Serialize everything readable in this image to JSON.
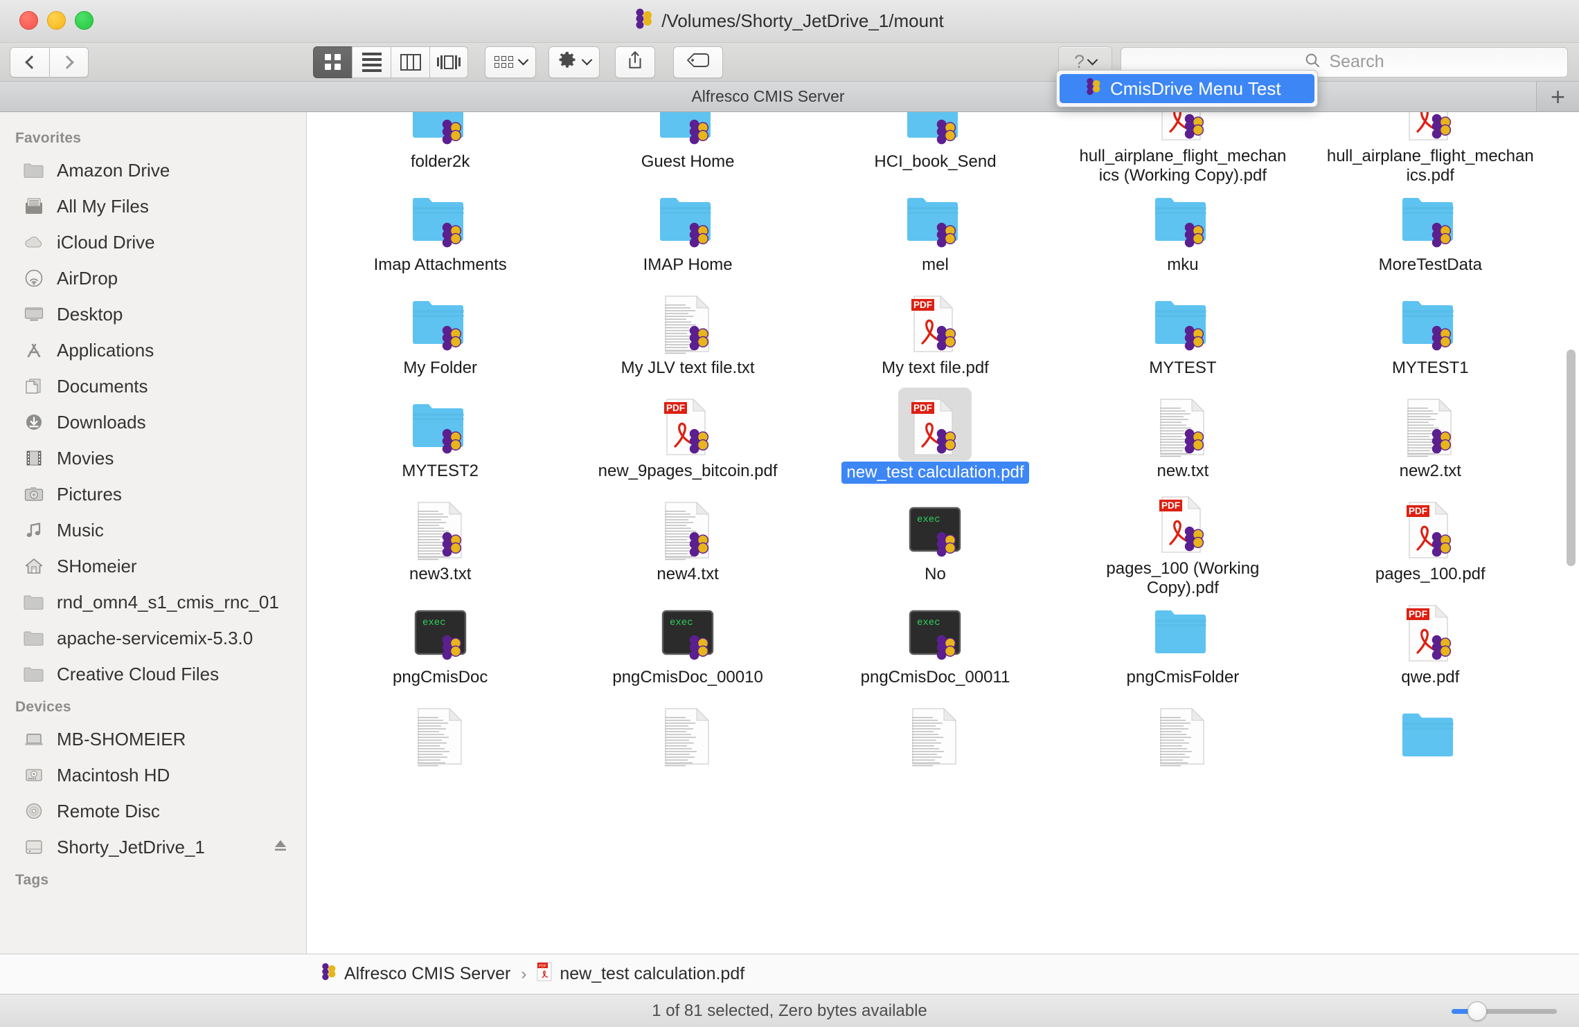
{
  "window": {
    "title": "/Volumes/Shorty_JetDrive_1/mount",
    "title_icon": "alfresco-logo-icon",
    "traffic_lights": [
      "close",
      "minimize",
      "zoom"
    ]
  },
  "toolbar": {
    "back_label": "Back",
    "forward_label": "Forward",
    "view_modes": [
      {
        "name": "icon-view",
        "active": true
      },
      {
        "name": "list-view",
        "active": false
      },
      {
        "name": "column-view",
        "active": false
      },
      {
        "name": "cover-flow-view",
        "active": false
      }
    ],
    "arrange_label": "Arrange",
    "action_label": "Action",
    "share_label": "Share",
    "tags_label": "Edit Tags",
    "help_label": "?",
    "search": {
      "placeholder": "Search",
      "value": ""
    }
  },
  "dropdown": {
    "open": true,
    "items": [
      {
        "label": "CmisDrive Menu Test",
        "icon": "alfresco-logo-icon",
        "selected": true
      }
    ]
  },
  "tabbar": {
    "tabs": [
      {
        "label": "Alfresco CMIS Server",
        "active": true
      }
    ],
    "add_label": "+"
  },
  "sidebar": {
    "sections": [
      {
        "header": "Favorites",
        "items": [
          {
            "label": "Amazon Drive",
            "icon": "folder-icon"
          },
          {
            "label": "All My Files",
            "icon": "all-my-files-icon"
          },
          {
            "label": "iCloud Drive",
            "icon": "cloud-icon"
          },
          {
            "label": "AirDrop",
            "icon": "airdrop-icon"
          },
          {
            "label": "Desktop",
            "icon": "desktop-icon"
          },
          {
            "label": "Applications",
            "icon": "applications-icon"
          },
          {
            "label": "Documents",
            "icon": "documents-icon"
          },
          {
            "label": "Downloads",
            "icon": "downloads-icon"
          },
          {
            "label": "Movies",
            "icon": "movies-icon"
          },
          {
            "label": "Pictures",
            "icon": "pictures-icon"
          },
          {
            "label": "Music",
            "icon": "music-icon"
          },
          {
            "label": "SHomeier",
            "icon": "home-icon"
          },
          {
            "label": "rnd_omn4_s1_cmis_rnc_01",
            "icon": "folder-icon"
          },
          {
            "label": "apache-servicemix-5.3.0",
            "icon": "folder-icon"
          },
          {
            "label": "Creative Cloud Files",
            "icon": "folder-icon"
          }
        ]
      },
      {
        "header": "Devices",
        "items": [
          {
            "label": "MB-SHOMEIER",
            "icon": "laptop-icon"
          },
          {
            "label": "Macintosh HD",
            "icon": "harddisk-icon"
          },
          {
            "label": "Remote Disc",
            "icon": "disc-icon"
          },
          {
            "label": "Shorty_JetDrive_1",
            "icon": "external-drive-icon",
            "eject": true
          }
        ]
      },
      {
        "header": "Tags",
        "items": []
      }
    ]
  },
  "files": [
    {
      "name": "folder2k",
      "type": "folder",
      "badge": true,
      "clipped_top": true
    },
    {
      "name": "Guest Home",
      "type": "folder",
      "badge": true,
      "clipped_top": true
    },
    {
      "name": "HCI_book_Send",
      "type": "folder",
      "badge": true,
      "clipped_top": true
    },
    {
      "name": "hull_airplane_flight_mechanics (Working Copy).pdf",
      "type": "pdf",
      "badge": true,
      "clipped_top": true
    },
    {
      "name": "hull_airplane_flight_mechanics.pdf",
      "type": "pdf",
      "badge": true,
      "clipped_top": true
    },
    {
      "name": "Imap Attachments",
      "type": "folder",
      "badge": true
    },
    {
      "name": "IMAP Home",
      "type": "folder",
      "badge": true
    },
    {
      "name": "mel",
      "type": "folder",
      "badge": true
    },
    {
      "name": "mku",
      "type": "folder",
      "badge": true
    },
    {
      "name": "MoreTestData",
      "type": "folder",
      "badge": true
    },
    {
      "name": "My Folder",
      "type": "folder",
      "badge": true
    },
    {
      "name": "My JLV text file.txt",
      "type": "text",
      "badge": true
    },
    {
      "name": "My text file.pdf",
      "type": "pdf",
      "badge": true
    },
    {
      "name": "MYTEST",
      "type": "folder",
      "badge": true
    },
    {
      "name": "MYTEST1",
      "type": "folder",
      "badge": true
    },
    {
      "name": "MYTEST2",
      "type": "folder",
      "badge": true
    },
    {
      "name": "new_9pages_bitcoin.pdf",
      "type": "pdf",
      "badge": true
    },
    {
      "name": "new_test calculation.pdf",
      "type": "pdf",
      "badge": true,
      "selected": true
    },
    {
      "name": "new.txt",
      "type": "text",
      "badge": true
    },
    {
      "name": "new2.txt",
      "type": "text",
      "badge": true
    },
    {
      "name": "new3.txt",
      "type": "text",
      "badge": true
    },
    {
      "name": "new4.txt",
      "type": "text",
      "badge": true
    },
    {
      "name": "No",
      "type": "exec",
      "badge": true
    },
    {
      "name": "pages_100 (Working Copy).pdf",
      "type": "pdf",
      "badge": true
    },
    {
      "name": "pages_100.pdf",
      "type": "pdf",
      "badge": true
    },
    {
      "name": "pngCmisDoc",
      "type": "exec",
      "badge": true
    },
    {
      "name": "pngCmisDoc_00010",
      "type": "exec",
      "badge": true
    },
    {
      "name": "pngCmisDoc_00011",
      "type": "exec",
      "badge": true
    },
    {
      "name": "pngCmisFolder",
      "type": "folder",
      "badge": false
    },
    {
      "name": "qwe.pdf",
      "type": "pdf",
      "badge": true
    },
    {
      "name": "",
      "type": "text",
      "badge": false,
      "clipped_bottom": true
    },
    {
      "name": "",
      "type": "text",
      "badge": false,
      "clipped_bottom": true
    },
    {
      "name": "",
      "type": "text",
      "badge": false,
      "clipped_bottom": true
    },
    {
      "name": "",
      "type": "text",
      "badge": false,
      "clipped_bottom": true
    },
    {
      "name": "",
      "type": "folder",
      "badge": false,
      "clipped_bottom": true
    }
  ],
  "pathbar": {
    "segments": [
      {
        "label": "Alfresco CMIS Server",
        "icon": "alfresco-logo-icon"
      },
      {
        "label": "new_test calculation.pdf",
        "icon": "pdf-icon"
      }
    ],
    "separator": "›"
  },
  "statusbar": {
    "text": "1 of 81 selected, Zero bytes available",
    "zoom_slider_percent": 22
  },
  "colors": {
    "accent_blue": "#3d86f5",
    "folder_blue": "#5ec3f0",
    "pdf_red": "#dd2012",
    "badge_purple": "#5b1f8f",
    "badge_gold": "#e8b51b",
    "exec_green": "#2fd05a"
  }
}
